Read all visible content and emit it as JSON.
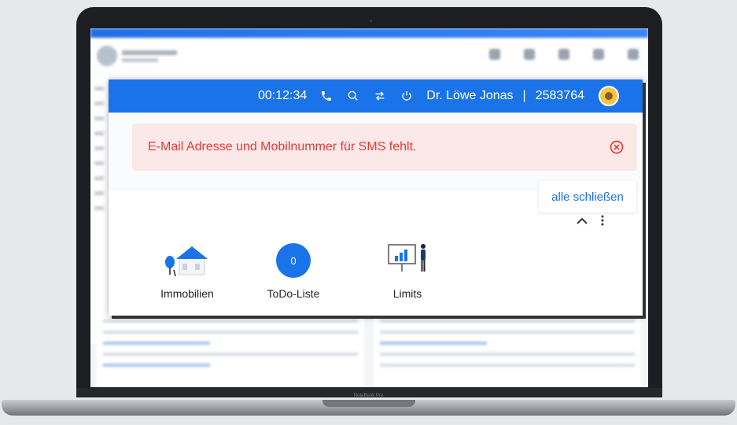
{
  "topbar": {
    "timer": "00:12:34",
    "user_name": "Dr. Löwe Jonas",
    "separator": "|",
    "user_id": "2583764"
  },
  "alert": {
    "message": "E-Mail Adresse und Mobilnummer für SMS fehlt."
  },
  "actions": {
    "close_all": "alle schließen"
  },
  "tiles": [
    {
      "label": "Immobilien"
    },
    {
      "label": "ToDo-Liste",
      "count": "0"
    },
    {
      "label": "Limits"
    }
  ],
  "laptop": {
    "brand": "NoteBook Pro"
  },
  "colors": {
    "primary": "#1a73e8",
    "alert_bg": "#fbe8e8",
    "alert_text": "#e53935"
  }
}
